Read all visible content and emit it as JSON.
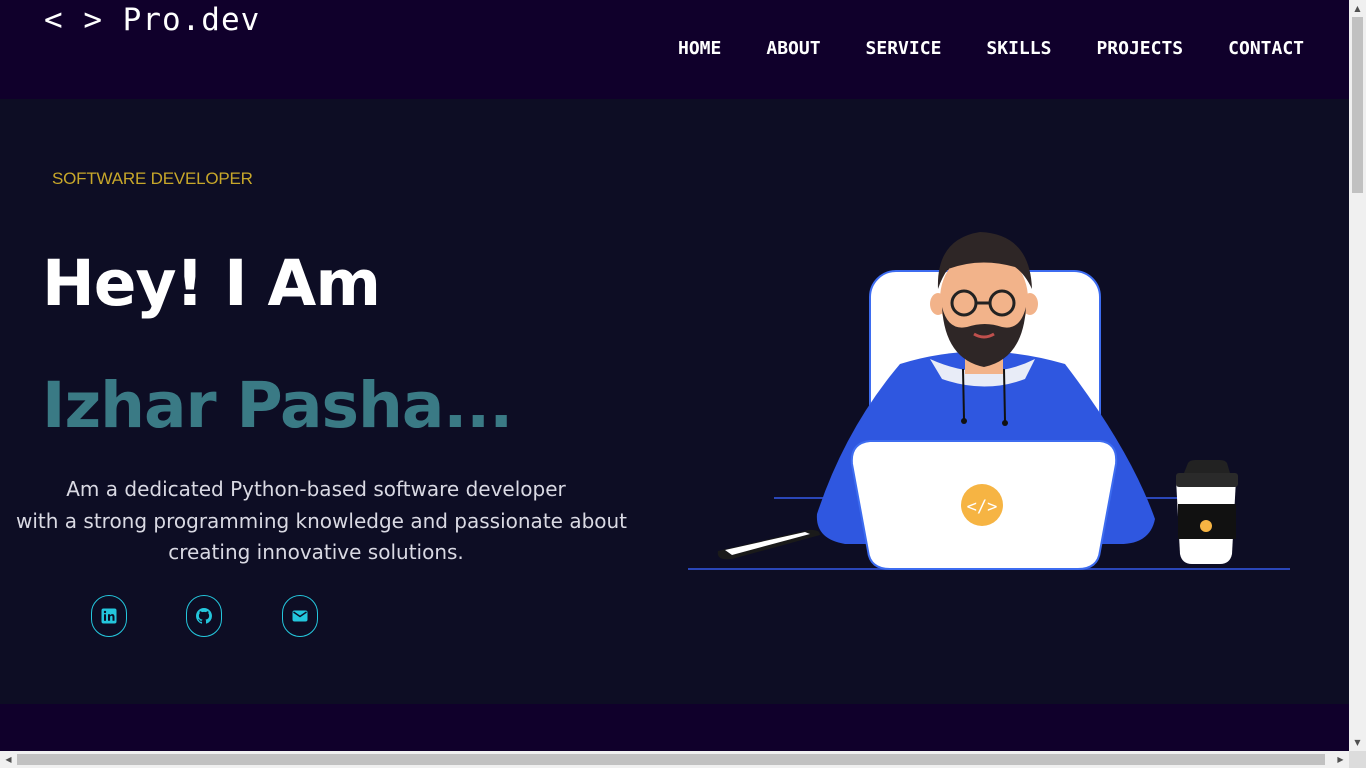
{
  "logo": {
    "text": "< > Pro.dev"
  },
  "nav": {
    "items": [
      {
        "label": "HOME"
      },
      {
        "label": "ABOUT"
      },
      {
        "label": "SERVICE"
      },
      {
        "label": "SKILLS"
      },
      {
        "label": "PROJECTS"
      },
      {
        "label": "CONTACT"
      }
    ]
  },
  "hero": {
    "tagline": "SOFTWARE DEVELOPER",
    "greeting": "Hey! I Am",
    "name": "Izhar Pasha...",
    "bio": [
      "Am a dedicated Python-based software developer",
      "with a strong programming knowledge and passionate about",
      "creating innovative solutions."
    ],
    "social": [
      {
        "icon": "linkedin-icon"
      },
      {
        "icon": "github-icon"
      },
      {
        "icon": "email-icon"
      }
    ]
  },
  "colors": {
    "nav_bg": "#10002b",
    "hero_bg": "#0d0d24",
    "tagline": "#c7a72a",
    "name": "#3a7a85",
    "social_accent": "#24c6dc"
  }
}
